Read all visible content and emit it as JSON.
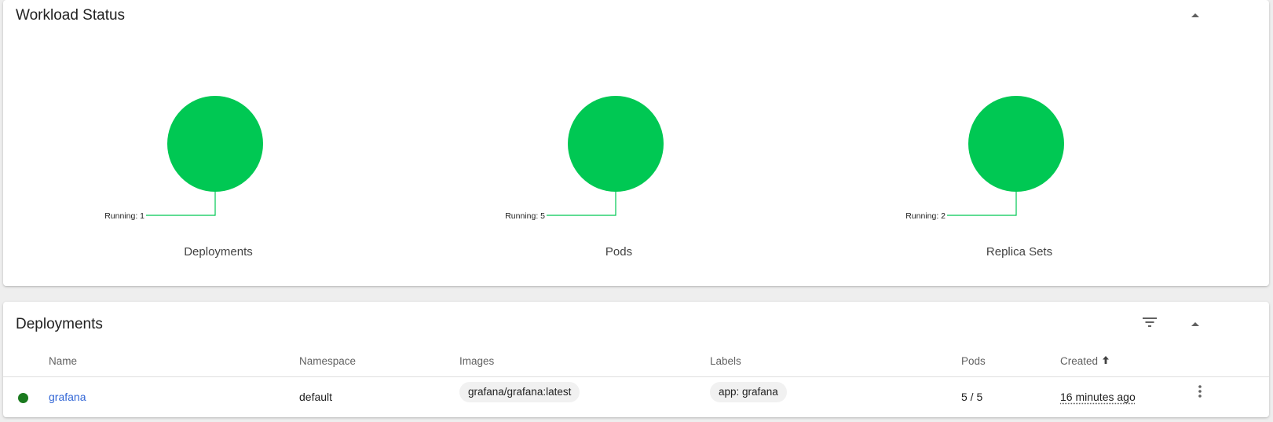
{
  "workload_status": {
    "title": "Workload Status",
    "colors": {
      "running": "#00c853",
      "leader_line": "#00c853"
    },
    "charts": [
      {
        "label": "Deployments",
        "running_label": "Running: 1",
        "running": 1
      },
      {
        "label": "Pods",
        "running_label": "Running: 5",
        "running": 5
      },
      {
        "label": "Replica Sets",
        "running_label": "Running: 2",
        "running": 2
      }
    ]
  },
  "deployments": {
    "title": "Deployments",
    "icons": {
      "filter": "filter-icon",
      "collapse": "chevron-up-icon",
      "sort": "arrow-up-icon",
      "menu": "more-vert-icon"
    },
    "columns": {
      "name": "Name",
      "namespace": "Namespace",
      "images": "Images",
      "labels": "Labels",
      "pods": "Pods",
      "created": "Created"
    },
    "rows": [
      {
        "status_color": "#1b7a1f",
        "name": "grafana",
        "namespace": "default",
        "image": "grafana/grafana:latest",
        "label": "app: grafana",
        "pods": "5 / 5",
        "created": "16 minutes ago"
      }
    ]
  },
  "chart_data": [
    {
      "type": "pie",
      "title": "Deployments",
      "categories": [
        "Running"
      ],
      "values": [
        1
      ]
    },
    {
      "type": "pie",
      "title": "Pods",
      "categories": [
        "Running"
      ],
      "values": [
        5
      ]
    },
    {
      "type": "pie",
      "title": "Replica Sets",
      "categories": [
        "Running"
      ],
      "values": [
        2
      ]
    }
  ]
}
